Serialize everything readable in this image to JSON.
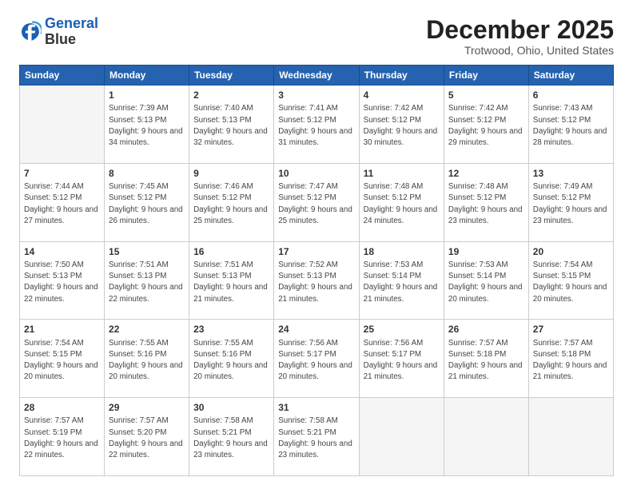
{
  "logo": {
    "line1": "General",
    "line2": "Blue"
  },
  "title": "December 2025",
  "subtitle": "Trotwood, Ohio, United States",
  "days_of_week": [
    "Sunday",
    "Monday",
    "Tuesday",
    "Wednesday",
    "Thursday",
    "Friday",
    "Saturday"
  ],
  "weeks": [
    [
      {
        "num": "",
        "empty": true
      },
      {
        "num": "1",
        "sunrise": "7:39 AM",
        "sunset": "5:13 PM",
        "daylight": "9 hours and 34 minutes."
      },
      {
        "num": "2",
        "sunrise": "7:40 AM",
        "sunset": "5:13 PM",
        "daylight": "9 hours and 32 minutes."
      },
      {
        "num": "3",
        "sunrise": "7:41 AM",
        "sunset": "5:12 PM",
        "daylight": "9 hours and 31 minutes."
      },
      {
        "num": "4",
        "sunrise": "7:42 AM",
        "sunset": "5:12 PM",
        "daylight": "9 hours and 30 minutes."
      },
      {
        "num": "5",
        "sunrise": "7:42 AM",
        "sunset": "5:12 PM",
        "daylight": "9 hours and 29 minutes."
      },
      {
        "num": "6",
        "sunrise": "7:43 AM",
        "sunset": "5:12 PM",
        "daylight": "9 hours and 28 minutes."
      }
    ],
    [
      {
        "num": "7",
        "sunrise": "7:44 AM",
        "sunset": "5:12 PM",
        "daylight": "9 hours and 27 minutes."
      },
      {
        "num": "8",
        "sunrise": "7:45 AM",
        "sunset": "5:12 PM",
        "daylight": "9 hours and 26 minutes."
      },
      {
        "num": "9",
        "sunrise": "7:46 AM",
        "sunset": "5:12 PM",
        "daylight": "9 hours and 25 minutes."
      },
      {
        "num": "10",
        "sunrise": "7:47 AM",
        "sunset": "5:12 PM",
        "daylight": "9 hours and 25 minutes."
      },
      {
        "num": "11",
        "sunrise": "7:48 AM",
        "sunset": "5:12 PM",
        "daylight": "9 hours and 24 minutes."
      },
      {
        "num": "12",
        "sunrise": "7:48 AM",
        "sunset": "5:12 PM",
        "daylight": "9 hours and 23 minutes."
      },
      {
        "num": "13",
        "sunrise": "7:49 AM",
        "sunset": "5:12 PM",
        "daylight": "9 hours and 23 minutes."
      }
    ],
    [
      {
        "num": "14",
        "sunrise": "7:50 AM",
        "sunset": "5:13 PM",
        "daylight": "9 hours and 22 minutes."
      },
      {
        "num": "15",
        "sunrise": "7:51 AM",
        "sunset": "5:13 PM",
        "daylight": "9 hours and 22 minutes."
      },
      {
        "num": "16",
        "sunrise": "7:51 AM",
        "sunset": "5:13 PM",
        "daylight": "9 hours and 21 minutes."
      },
      {
        "num": "17",
        "sunrise": "7:52 AM",
        "sunset": "5:13 PM",
        "daylight": "9 hours and 21 minutes."
      },
      {
        "num": "18",
        "sunrise": "7:53 AM",
        "sunset": "5:14 PM",
        "daylight": "9 hours and 21 minutes."
      },
      {
        "num": "19",
        "sunrise": "7:53 AM",
        "sunset": "5:14 PM",
        "daylight": "9 hours and 20 minutes."
      },
      {
        "num": "20",
        "sunrise": "7:54 AM",
        "sunset": "5:15 PM",
        "daylight": "9 hours and 20 minutes."
      }
    ],
    [
      {
        "num": "21",
        "sunrise": "7:54 AM",
        "sunset": "5:15 PM",
        "daylight": "9 hours and 20 minutes."
      },
      {
        "num": "22",
        "sunrise": "7:55 AM",
        "sunset": "5:16 PM",
        "daylight": "9 hours and 20 minutes."
      },
      {
        "num": "23",
        "sunrise": "7:55 AM",
        "sunset": "5:16 PM",
        "daylight": "9 hours and 20 minutes."
      },
      {
        "num": "24",
        "sunrise": "7:56 AM",
        "sunset": "5:17 PM",
        "daylight": "9 hours and 20 minutes."
      },
      {
        "num": "25",
        "sunrise": "7:56 AM",
        "sunset": "5:17 PM",
        "daylight": "9 hours and 21 minutes."
      },
      {
        "num": "26",
        "sunrise": "7:57 AM",
        "sunset": "5:18 PM",
        "daylight": "9 hours and 21 minutes."
      },
      {
        "num": "27",
        "sunrise": "7:57 AM",
        "sunset": "5:18 PM",
        "daylight": "9 hours and 21 minutes."
      }
    ],
    [
      {
        "num": "28",
        "sunrise": "7:57 AM",
        "sunset": "5:19 PM",
        "daylight": "9 hours and 22 minutes."
      },
      {
        "num": "29",
        "sunrise": "7:57 AM",
        "sunset": "5:20 PM",
        "daylight": "9 hours and 22 minutes."
      },
      {
        "num": "30",
        "sunrise": "7:58 AM",
        "sunset": "5:21 PM",
        "daylight": "9 hours and 23 minutes."
      },
      {
        "num": "31",
        "sunrise": "7:58 AM",
        "sunset": "5:21 PM",
        "daylight": "9 hours and 23 minutes."
      },
      {
        "num": "",
        "empty": true
      },
      {
        "num": "",
        "empty": true
      },
      {
        "num": "",
        "empty": true
      }
    ]
  ]
}
